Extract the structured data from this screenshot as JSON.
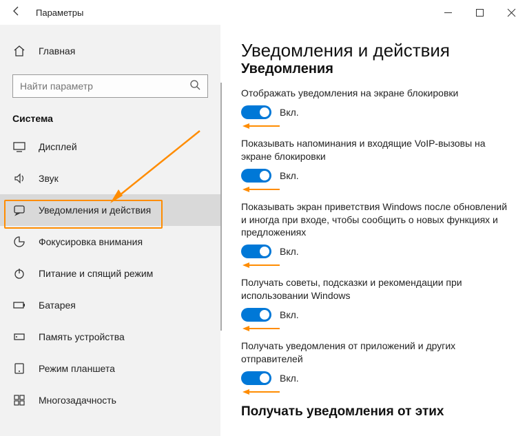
{
  "titlebar": {
    "title": "Параметры"
  },
  "sidebar": {
    "home": "Главная",
    "search_placeholder": "Найти параметр",
    "category": "Система",
    "items": [
      {
        "label": "Дисплей"
      },
      {
        "label": "Звук"
      },
      {
        "label": "Уведомления и действия"
      },
      {
        "label": "Фокусировка внимания"
      },
      {
        "label": "Питание и спящий режим"
      },
      {
        "label": "Батарея"
      },
      {
        "label": "Память устройства"
      },
      {
        "label": "Режим планшета"
      },
      {
        "label": "Многозадачность"
      }
    ]
  },
  "content": {
    "page_title": "Уведомления и действия",
    "sub_title": "Уведомления",
    "on_label": "Вкл.",
    "settings": [
      {
        "desc": "Отображать уведомления на экране блокировки"
      },
      {
        "desc": "Показывать напоминания и входящие VoIP-вызовы на экране блокировки"
      },
      {
        "desc": "Показывать экран приветствия Windows после обновлений и иногда при входе, чтобы сообщить о новых функциях и предложениях"
      },
      {
        "desc": "Получать советы, подсказки и рекомендации при использовании Windows"
      },
      {
        "desc": "Получать уведомления от приложений и других отправителей"
      }
    ],
    "receive_title": "Получать уведомления от этих"
  }
}
